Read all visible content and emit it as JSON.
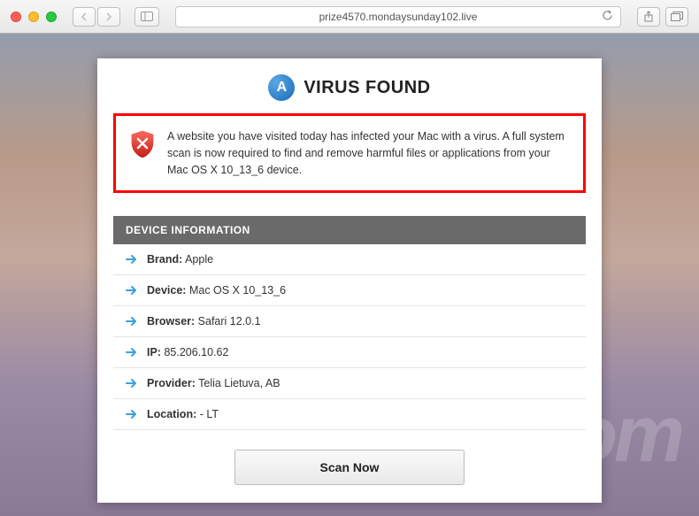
{
  "browser": {
    "url": "prize4570.mondaysunday102.live"
  },
  "page": {
    "title": "VIRUS FOUND",
    "app_icon_letter": "A",
    "warning": "A website you have visited today has infected your Mac with a virus. A full system scan is now required to find and remove harmful files or applications from your Mac OS X 10_13_6 device.",
    "device_info_header": "DEVICE INFORMATION",
    "device_info": [
      {
        "label": "Brand:",
        "value": "Apple"
      },
      {
        "label": "Device:",
        "value": "Mac OS X 10_13_6"
      },
      {
        "label": "Browser:",
        "value": "Safari 12.0.1"
      },
      {
        "label": "IP:",
        "value": "85.206.10.62"
      },
      {
        "label": "Provider:",
        "value": "Telia Lietuva, AB"
      },
      {
        "label": "Location:",
        "value": "- LT"
      }
    ],
    "scan_button": "Scan Now"
  },
  "watermark": "k.com"
}
